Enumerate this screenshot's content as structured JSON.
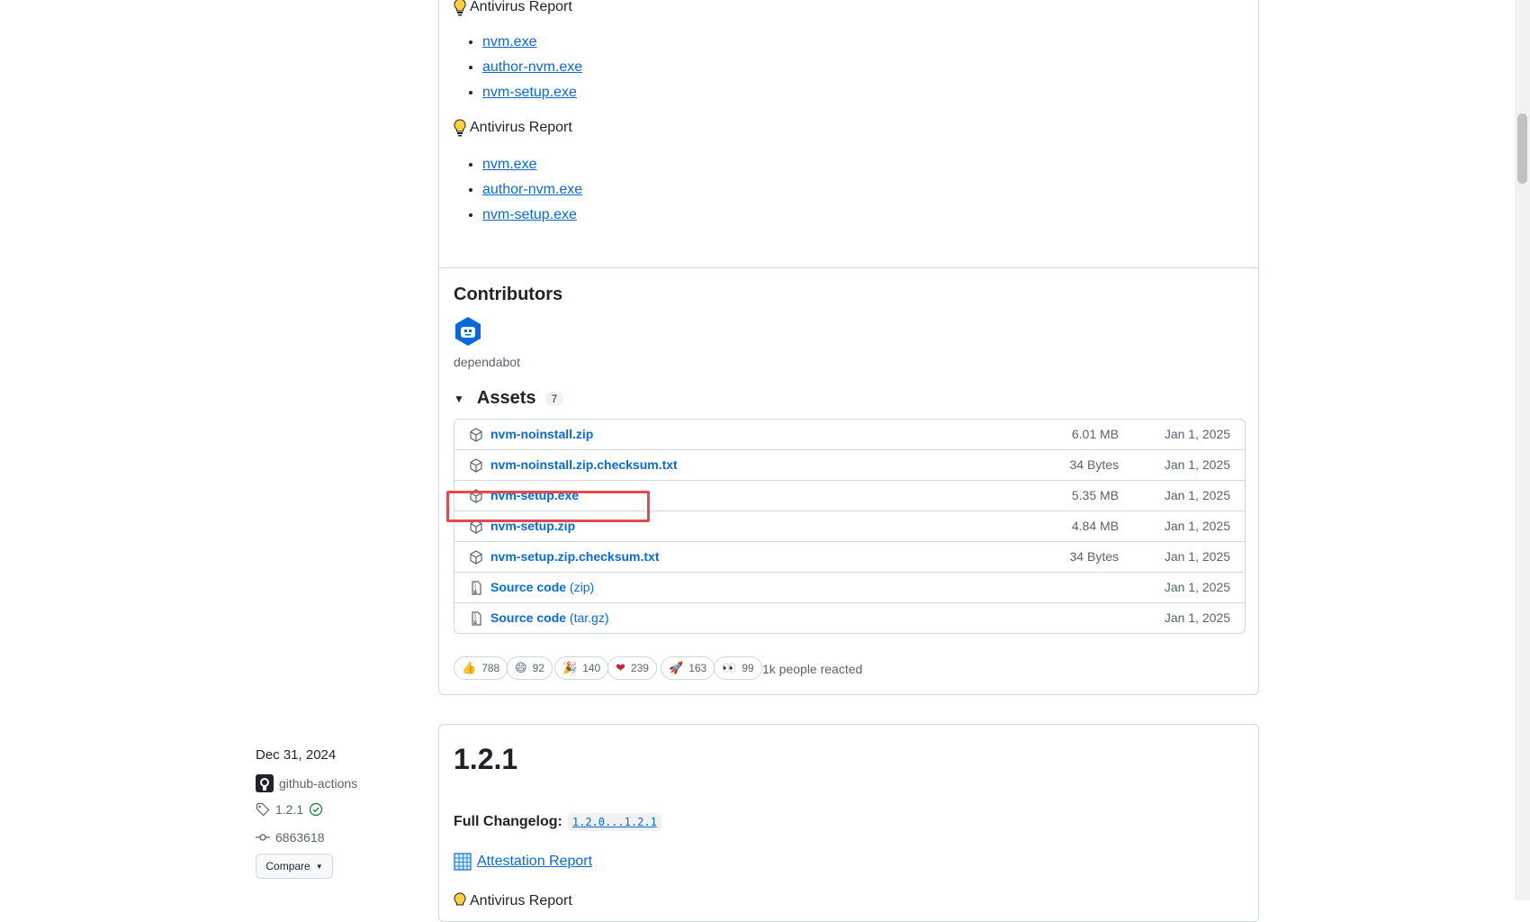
{
  "antivirus_sections": [
    {
      "heading": "Antivirus Report",
      "links": [
        "nvm.exe",
        "author-nvm.exe",
        "nvm-setup.exe"
      ]
    },
    {
      "heading": "Antivirus Report",
      "links": [
        "nvm.exe",
        "author-nvm.exe",
        "nvm-setup.exe"
      ]
    }
  ],
  "contributors": {
    "title": "Contributors",
    "name": "dependabot"
  },
  "assets": {
    "title": "Assets",
    "count": "7",
    "items": [
      {
        "name": "nvm-noinstall.zip",
        "size": "6.01 MB",
        "date": "Jan 1, 2025",
        "icon": "package-icon"
      },
      {
        "name": "nvm-noinstall.zip.checksum.txt",
        "size": "34 Bytes",
        "date": "Jan 1, 2025",
        "icon": "package-icon"
      },
      {
        "name": "nvm-setup.exe",
        "size": "5.35 MB",
        "date": "Jan 1, 2025",
        "icon": "package-icon"
      },
      {
        "name": "nvm-setup.zip",
        "size": "4.84 MB",
        "date": "Jan 1, 2025",
        "icon": "package-icon"
      },
      {
        "name": "nvm-setup.zip.checksum.txt",
        "size": "34 Bytes",
        "date": "Jan 1, 2025",
        "icon": "package-icon"
      },
      {
        "name": "Source code",
        "suffix": "(zip)",
        "size": "",
        "date": "Jan 1, 2025",
        "icon": "file-zip-icon"
      },
      {
        "name": "Source code",
        "suffix": "(tar.gz)",
        "size": "",
        "date": "Jan 1, 2025",
        "icon": "file-zip-icon"
      }
    ]
  },
  "reactions": [
    {
      "emoji": "👍",
      "count": "788",
      "icon": "thumbs-up-icon"
    },
    {
      "emoji": "😄",
      "count": "92",
      "icon": "laugh-icon"
    },
    {
      "emoji": "🎉",
      "count": "140",
      "icon": "hooray-icon"
    },
    {
      "emoji": "❤",
      "count": "239",
      "icon": "heart-icon"
    },
    {
      "emoji": "🚀",
      "count": "163",
      "icon": "rocket-icon"
    },
    {
      "emoji": "👀",
      "count": "99",
      "icon": "eyes-icon"
    }
  ],
  "reactions_summary": "1k people reacted",
  "release": {
    "date": "Dec 31, 2024",
    "author": "github-actions",
    "tag": "1.2.1",
    "commit": "6863618",
    "compare_label": "Compare",
    "title": "1.2.1",
    "changelog_label": "Full Changelog:",
    "changelog_link": "1.2.0...1.2.1",
    "attestation_label": "Attestation Report",
    "antivirus_partial": "Antivirus Report"
  },
  "colors": {
    "link": "#0969da",
    "highlight": "#e5484d",
    "verified": "#1a7f37"
  }
}
